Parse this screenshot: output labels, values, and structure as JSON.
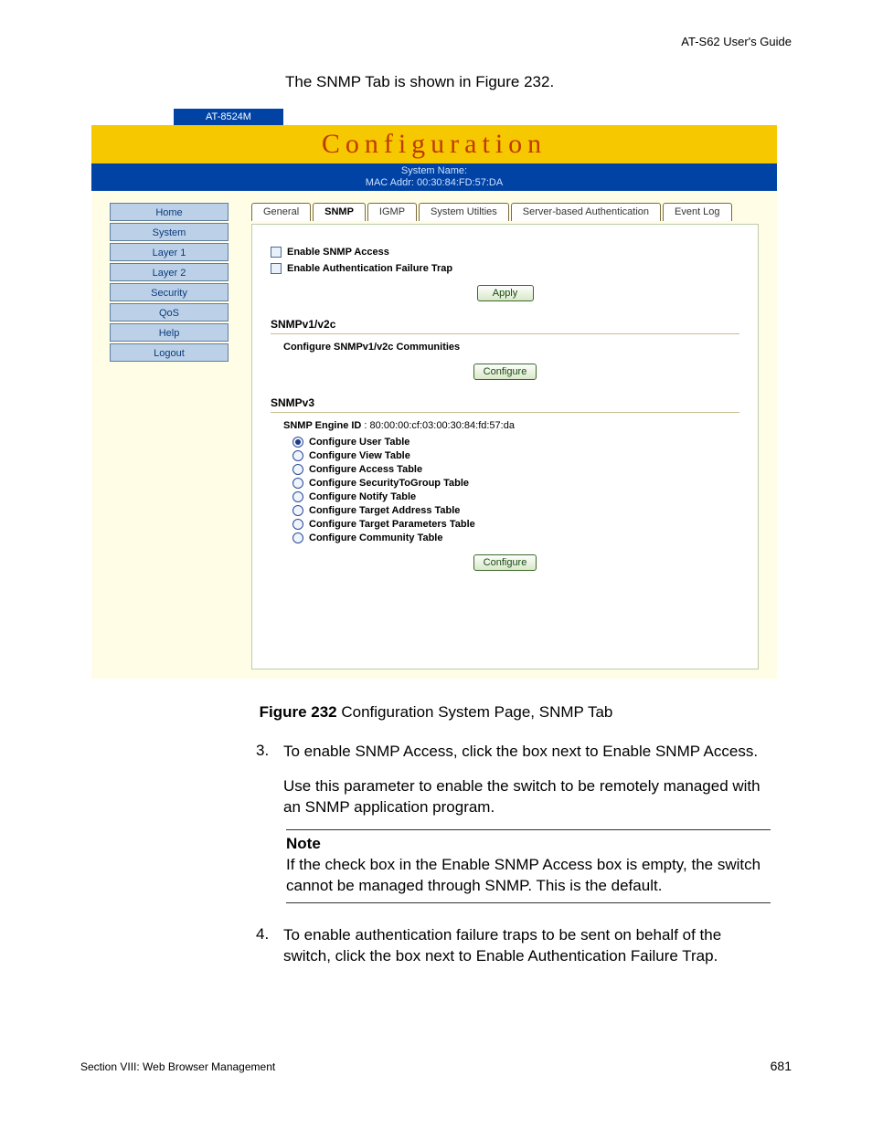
{
  "header_right": "AT-S62  User's Guide",
  "intro": "The SNMP Tab is shown in Figure 232.",
  "figure": {
    "label": "Figure 232",
    "caption": "  Configuration System Page, SNMP Tab"
  },
  "step3": {
    "num": "3.",
    "line1": "To enable SNMP Access, click the box next to Enable SNMP Access.",
    "line2": "Use this parameter to enable the switch to be remotely managed with an SNMP application program."
  },
  "note": {
    "label": "Note",
    "text": "If the check box in the Enable SNMP Access box is empty, the switch cannot be managed through SNMP. This is the default."
  },
  "step4": {
    "num": "4.",
    "text": "To enable authentication failure traps to be sent on behalf of the switch, click the box next to Enable Authentication Failure Trap."
  },
  "footer": {
    "left": "Section VIII: Web Browser Management",
    "right": "681"
  },
  "ui": {
    "model": "AT-8524M",
    "title": "Configuration",
    "sysname_label": "System Name:",
    "mac_label": "MAC Addr: 00:30:84:FD:57:DA",
    "nav": [
      "Home",
      "System",
      "Layer 1",
      "Layer 2",
      "Security",
      "QoS",
      "Help",
      "Logout"
    ],
    "tabs": [
      "General",
      "SNMP",
      "IGMP",
      "System Utilties",
      "Server-based Authentication",
      "Event Log"
    ],
    "cb1": "Enable SNMP Access",
    "cb2": "Enable Authentication Failure Trap",
    "apply": "Apply",
    "v1head": "SNMPv1/v2c",
    "v1sub": "Configure SNMPv1/v2c Communities",
    "configure": "Configure",
    "v3head": "SNMPv3",
    "engine_label": "SNMP Engine ID",
    "engine_val": " : 80:00:00:cf:03:00:30:84:fd:57:da",
    "radios": [
      "Configure User Table",
      "Configure View Table",
      "Configure Access Table",
      "Configure SecurityToGroup Table",
      "Configure Notify Table",
      "Configure Target Address Table",
      "Configure Target Parameters Table",
      "Configure Community Table"
    ]
  }
}
